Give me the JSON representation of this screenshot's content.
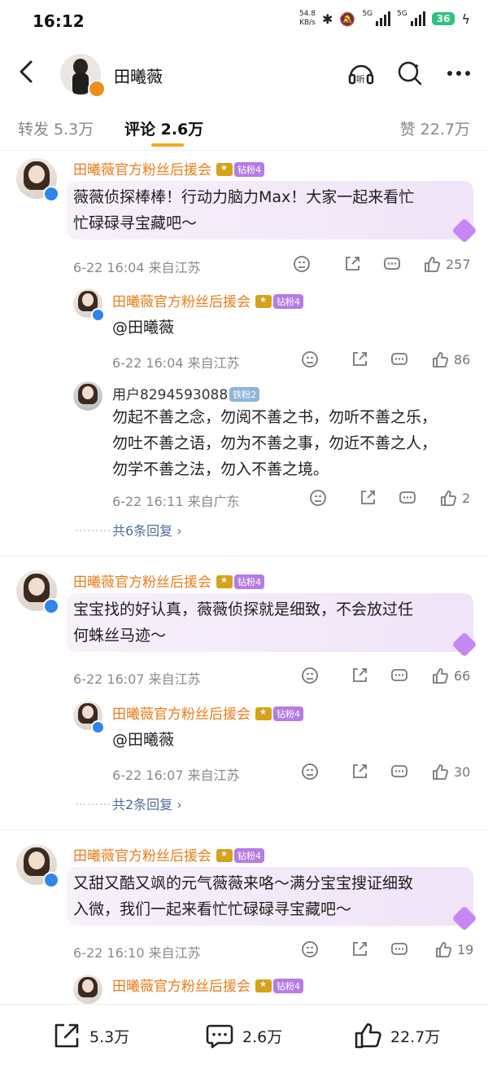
{
  "status": {
    "time": "16:12",
    "speed": "54.8",
    "speed_unit": "KB/s",
    "net1": "5G",
    "net2": "5G",
    "battery": "36"
  },
  "nav": {
    "title": "田曦薇"
  },
  "tabs": {
    "repost": "转发 5.3万",
    "comment": "评论 2.6万",
    "like": "赞 22.7万"
  },
  "comments": [
    {
      "user": "田曦薇官方粉丝后援会",
      "badge": "钻粉4",
      "text1": "薇薇侦探棒棒！行动力脑力Max！大家一起来看忙",
      "text2": "忙碌碌寻宝藏吧～",
      "time": "6-22 16:04  来自江苏",
      "likes": "257"
    },
    {
      "user": "田曦薇官方粉丝后援会",
      "badge": "钻粉4",
      "text": "@田曦薇",
      "time": "6-22 16:04  来自江苏",
      "likes": "86"
    },
    {
      "user": "用户8294593088",
      "badge": "铁粉2",
      "text1": "勿起不善之念，勿阅不善之书，勿听不善之乐，",
      "text2": "勿吐不善之语，勿为不善之事，勿近不善之人，",
      "text3": "勿学不善之法，勿入不善之境。",
      "time": "6-22 16:11  来自广东",
      "likes": "2"
    },
    {
      "more": "共6条回复"
    },
    {
      "user": "田曦薇官方粉丝后援会",
      "badge": "钻粉4",
      "text1": "宝宝找的好认真，薇薇侦探就是细致，不会放过任",
      "text2": "何蛛丝马迹～",
      "time": "6-22 16:07  来自江苏",
      "likes": "66"
    },
    {
      "user": "田曦薇官方粉丝后援会",
      "badge": "钻粉4",
      "text": "@田曦薇",
      "time": "6-22 16:07  来自江苏",
      "likes": "30"
    },
    {
      "more": "共2条回复"
    },
    {
      "user": "田曦薇官方粉丝后援会",
      "badge": "钻粉4",
      "text1": "又甜又酷又飒的元气薇薇来咯～满分宝宝搜证细致",
      "text2": "入微，我们一起来看忙忙碌碌寻宝藏吧～",
      "time": "6-22 16:10  来自江苏",
      "likes": "19"
    },
    {
      "user": "田曦薇官方粉丝后援会",
      "badge": "钻粉4"
    }
  ],
  "bottom": {
    "repost": "5.3万",
    "comment": "2.6万",
    "like": "22.7万"
  },
  "colors": {
    "accent": "#f5a623",
    "username": "#ea7d1b",
    "link": "#4f6d9a"
  }
}
